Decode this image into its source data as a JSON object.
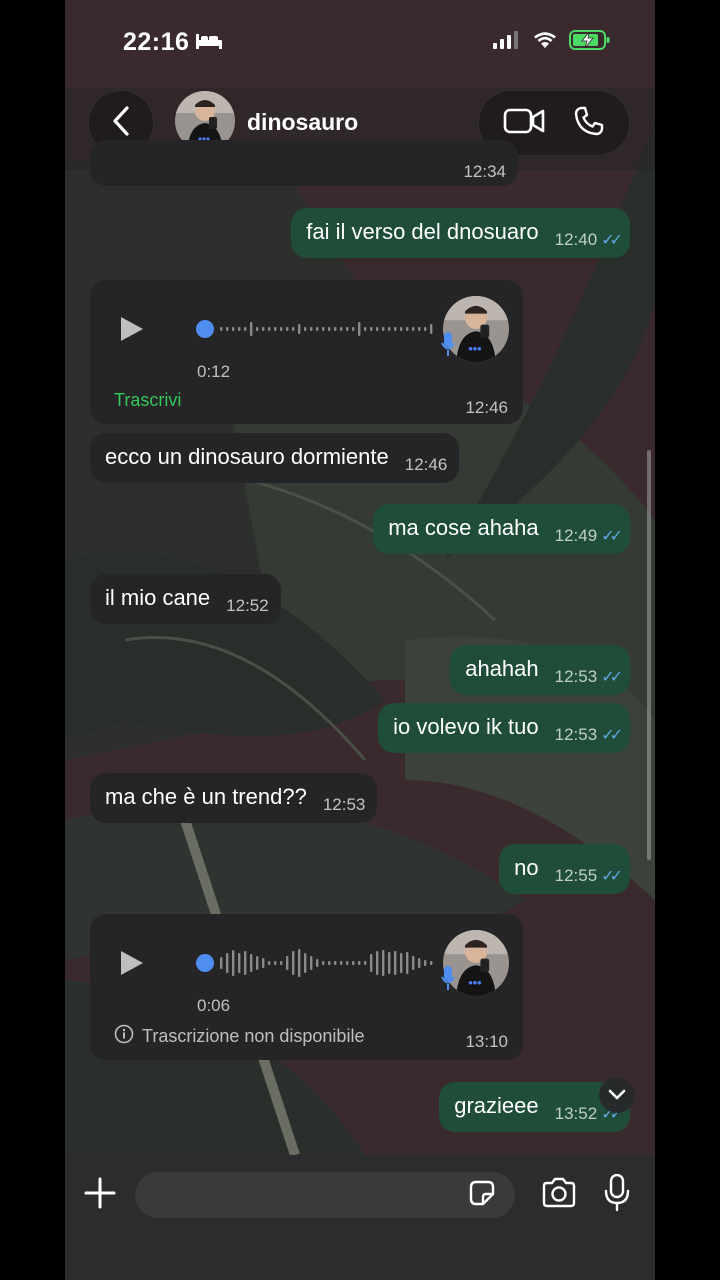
{
  "status_bar": {
    "time": "22:16"
  },
  "header": {
    "contact_name": "dinosauro"
  },
  "messages": {
    "partial_time": "12:34",
    "m1": {
      "text": "fai il verso del dnosuaro",
      "time": "12:40"
    },
    "voice1": {
      "duration": "0:12",
      "link": "Trascrivi",
      "time": "12:46"
    },
    "m2": {
      "text": "ecco un dinosauro dormiente",
      "time": "12:46"
    },
    "m3": {
      "text": "ma cose ahaha",
      "time": "12:49"
    },
    "m4": {
      "text": "il mio cane",
      "time": "12:52"
    },
    "m5": {
      "text": "ahahah",
      "time": "12:53"
    },
    "m6": {
      "text": "io volevo ik tuo",
      "time": "12:53"
    },
    "m7": {
      "text": "ma che è un trend??",
      "time": "12:53"
    },
    "m8": {
      "text": "no",
      "time": "12:55"
    },
    "voice2": {
      "duration": "0:06",
      "note": "Trascrizione non disponibile",
      "time": "13:10"
    },
    "m9": {
      "text": "grazieee",
      "time": "13:52"
    }
  },
  "input": {
    "placeholder": ""
  },
  "colors": {
    "incoming_bubble": "#252527",
    "outgoing_bubble": "#1f4d39",
    "read_ticks": "#5fa8e6",
    "link_green": "#34c759",
    "battery_green": "#4cd964"
  }
}
